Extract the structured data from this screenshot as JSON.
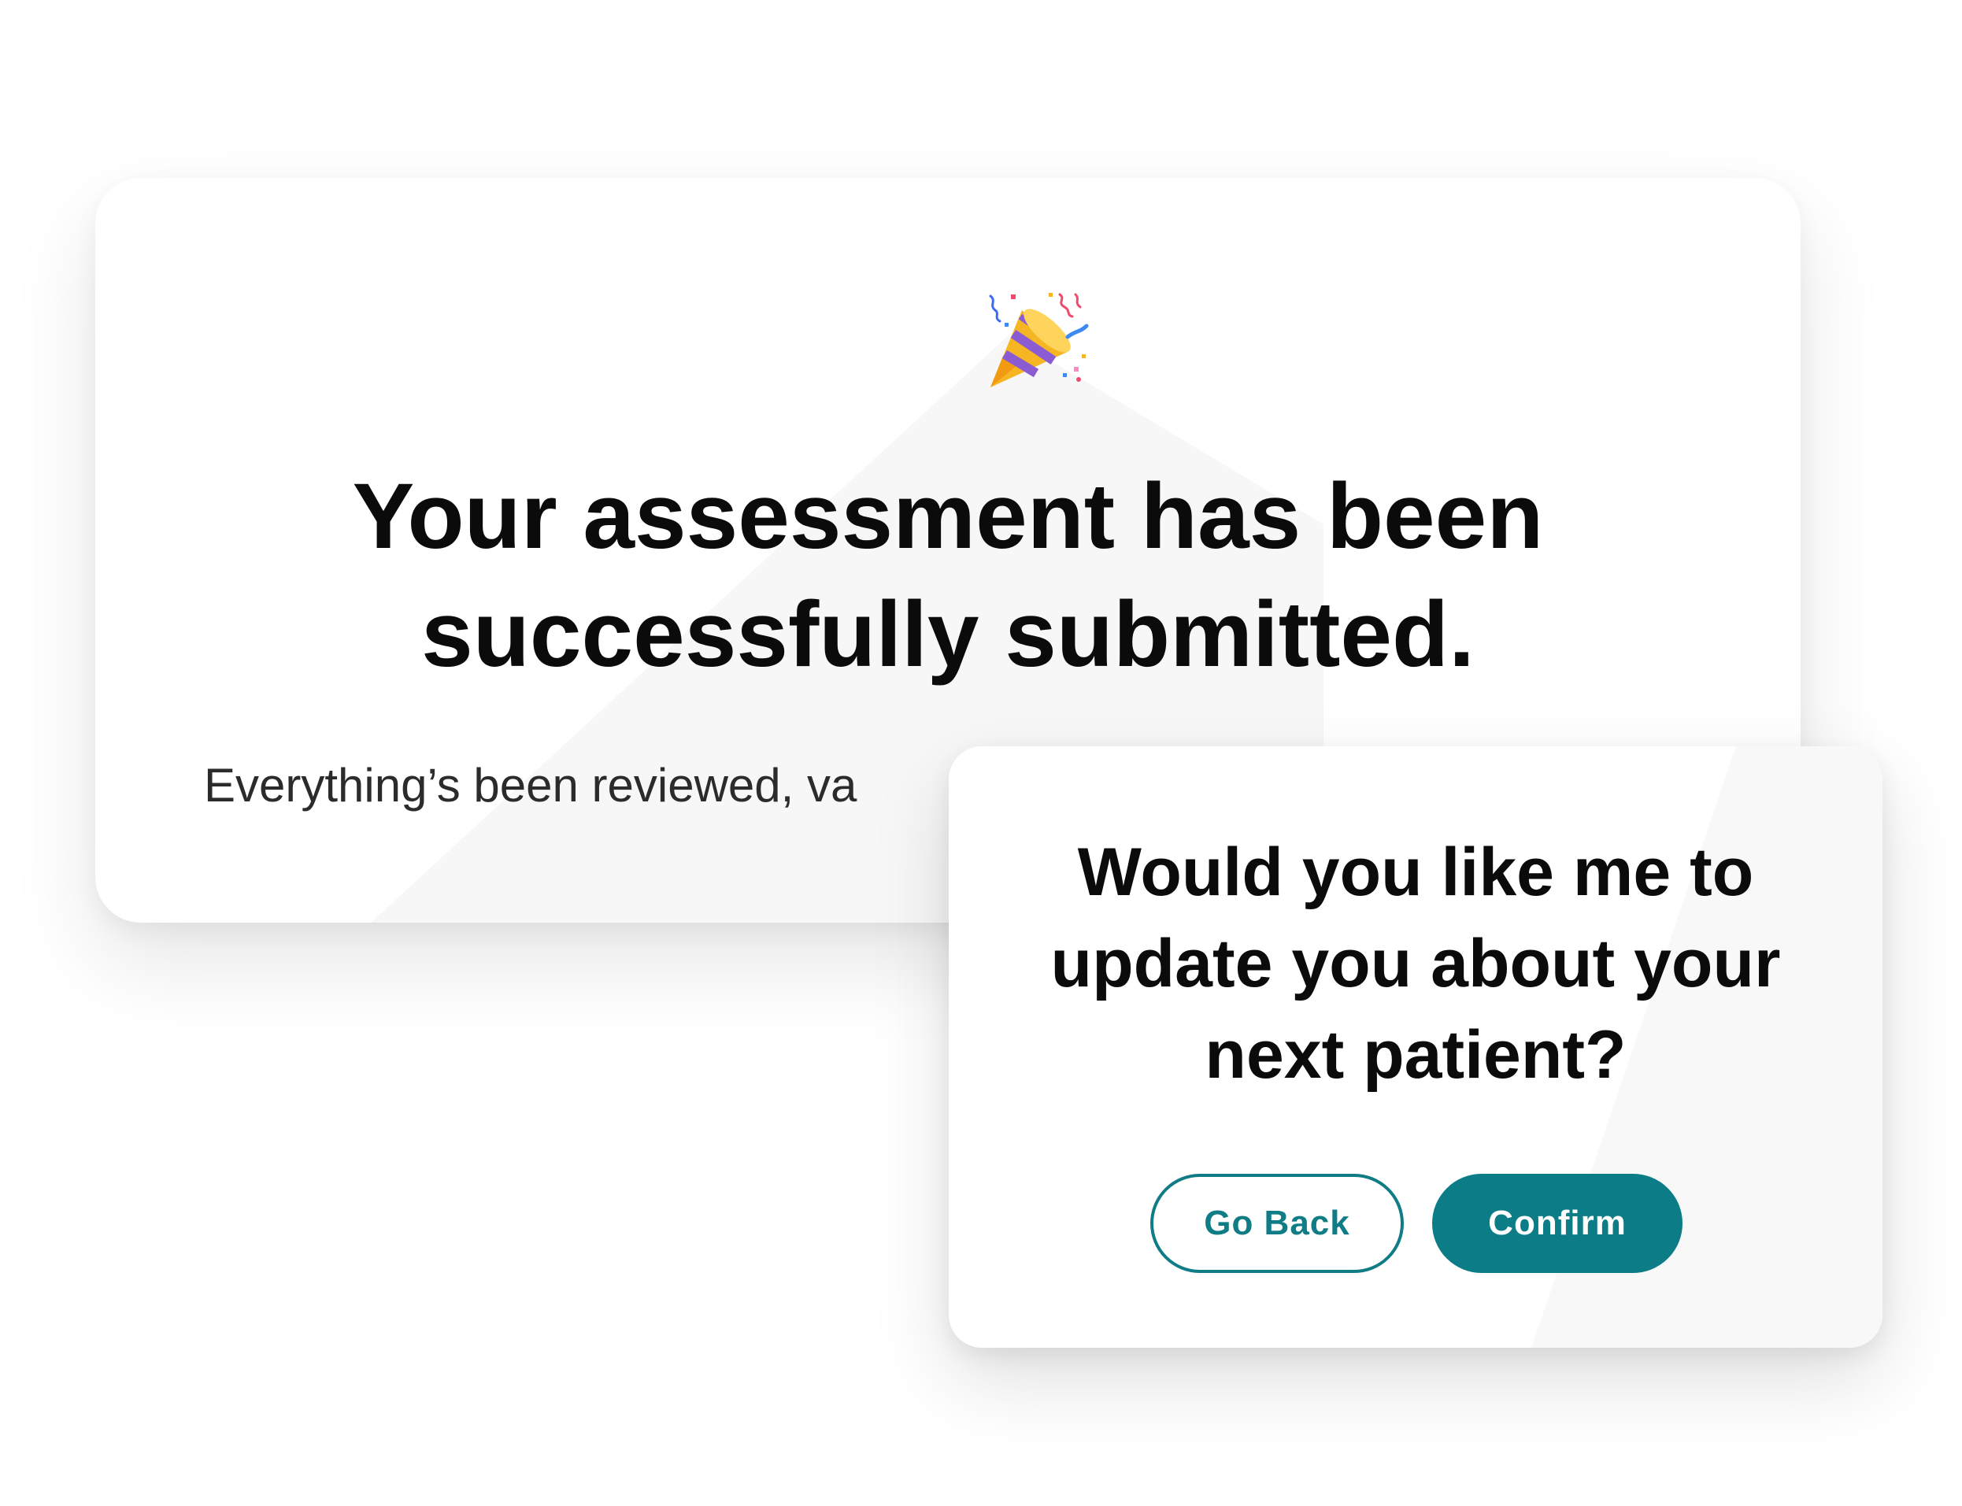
{
  "main_card": {
    "emoji_icon": "party-popper-icon",
    "headline_line1": "Your assessment has been",
    "headline_line2": "successfully submitted.",
    "subtext": "Everything’s been reviewed, va"
  },
  "dialog": {
    "question_line1": "Would you like me to",
    "question_line2": "update you about your",
    "question_line3": "next patient?",
    "go_back_label": "Go Back",
    "confirm_label": "Confirm"
  },
  "colors": {
    "accent": "#0c7c87",
    "text_primary": "#0b0b0b",
    "text_secondary": "#2b2b2e",
    "background": "#ffffff"
  }
}
